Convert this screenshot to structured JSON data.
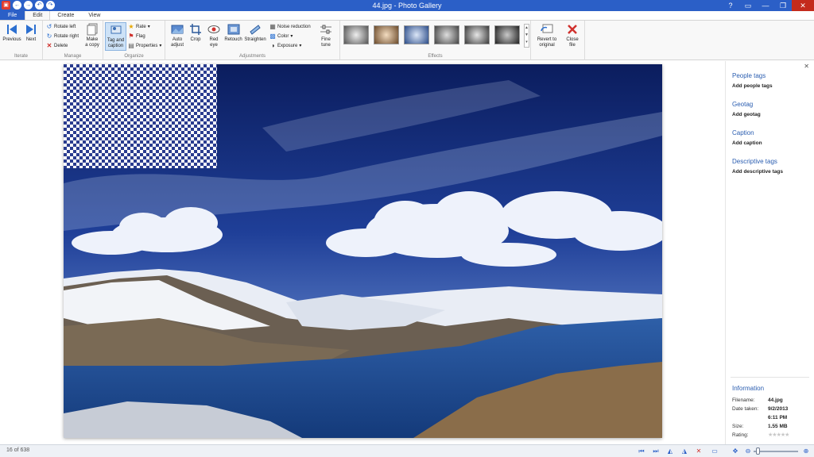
{
  "window": {
    "title": "44.jpg - Photo Gallery",
    "controls": [
      "?",
      "▭",
      "—",
      "❐",
      "✕"
    ]
  },
  "quick_access": [
    "←",
    "→",
    "↶",
    "↷"
  ],
  "tabs": [
    {
      "label": "File"
    },
    {
      "label": "Edit"
    },
    {
      "label": "Create"
    },
    {
      "label": "View"
    }
  ],
  "ribbon": {
    "iterate": {
      "label": "Iterate",
      "previous": "Previous",
      "next": "Next"
    },
    "manage": {
      "label": "Manage",
      "rotate_left": "Rotate left",
      "rotate_right": "Rotate right",
      "delete": "Delete",
      "make_copy_1": "Make",
      "make_copy_2": "a copy"
    },
    "organize": {
      "label": "Organize",
      "tag_caption_1": "Tag and",
      "tag_caption_2": "caption",
      "rate": "Rate",
      "flag": "Flag",
      "properties": "Properties"
    },
    "adjustments": {
      "label": "Adjustments",
      "auto_adjust_1": "Auto",
      "auto_adjust_2": "adjust",
      "crop": "Crop",
      "red_eye_1": "Red",
      "red_eye_2": "eye",
      "retouch": "Retouch",
      "straighten": "Straighten",
      "noise_reduction": "Noise reduction",
      "color": "Color",
      "exposure": "Exposure",
      "fine_tune_1": "Fine",
      "fine_tune_2": "tune"
    },
    "effects": {
      "label": "Effects",
      "revert_1": "Revert to",
      "revert_2": "original",
      "close_1": "Close",
      "close_2": "file"
    }
  },
  "details": {
    "people_tags": "People tags",
    "add_people_tags": "Add people tags",
    "geotag": "Geotag",
    "add_geotag": "Add geotag",
    "caption": "Caption",
    "add_caption": "Add caption",
    "descriptive_tags": "Descriptive tags",
    "add_descriptive_tags": "Add descriptive tags",
    "information": "Information",
    "filename_label": "Filename:",
    "filename": "44.jpg",
    "date_label": "Date taken:",
    "date": "9/2/2013",
    "time": "6:11 PM",
    "size_label": "Size:",
    "size": "1.55 MB",
    "rating_label": "Rating:",
    "rating": 0,
    "close": "✕"
  },
  "status": {
    "count": "16 of 638",
    "zoom_fraction": 0.05
  },
  "colors": {
    "accent": "#2b5fc7",
    "link": "#2a5db0",
    "close": "#c42b1c"
  }
}
